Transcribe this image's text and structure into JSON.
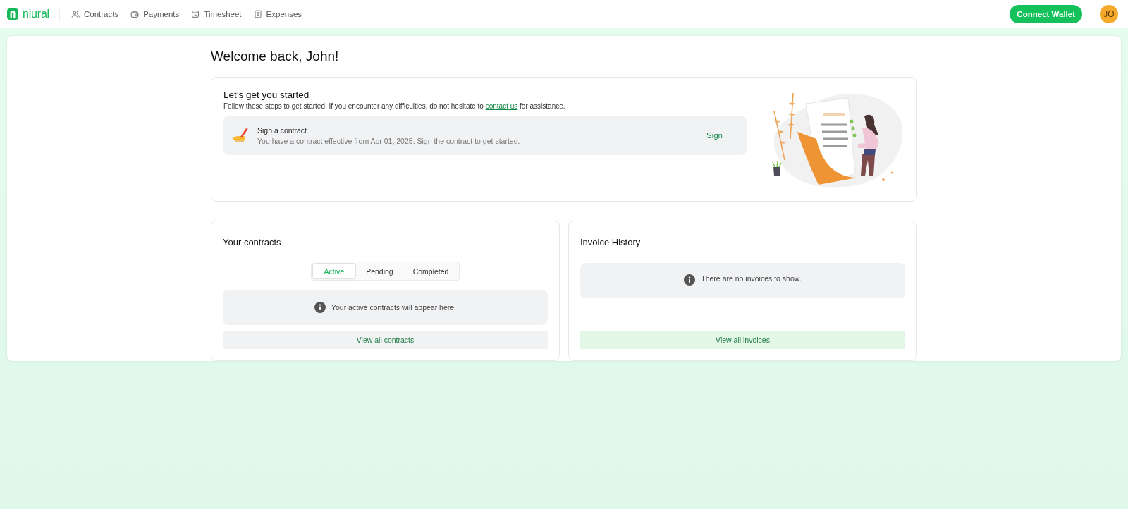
{
  "brand": {
    "name": "niural"
  },
  "nav": [
    {
      "label": "Contracts",
      "kind": "people"
    },
    {
      "label": "Payments",
      "kind": "wallet"
    },
    {
      "label": "Timesheet",
      "kind": "calendar"
    },
    {
      "label": "Expenses",
      "kind": "receipt"
    }
  ],
  "connect_button": "Connect Wallet",
  "avatar": {
    "initials": "JO"
  },
  "welcome": "Welcome back, John!",
  "getting_started": {
    "title": "Let’s get you started",
    "intro": {
      "before": "Follow these steps to get started. If you encounter any difficulties, do not hesitate to ",
      "link": "contact us",
      "after": " for assistance."
    },
    "task": {
      "title": "Sign a contract",
      "description": "You have a contract effective from Apr 01, 2025. Sign the contract to get started.",
      "action": "Sign"
    }
  },
  "contracts": {
    "title": "Your contracts",
    "tabs": [
      {
        "label": "Active",
        "selected": true
      },
      {
        "label": "Pending",
        "selected": false
      },
      {
        "label": "Completed",
        "selected": false
      }
    ],
    "empty_message": "Your active contracts will appear here.",
    "view_all": "View all contracts"
  },
  "invoices": {
    "title": "Invoice History",
    "empty_message": "There are no invoices to show.",
    "view_all": "View all invoices"
  }
}
